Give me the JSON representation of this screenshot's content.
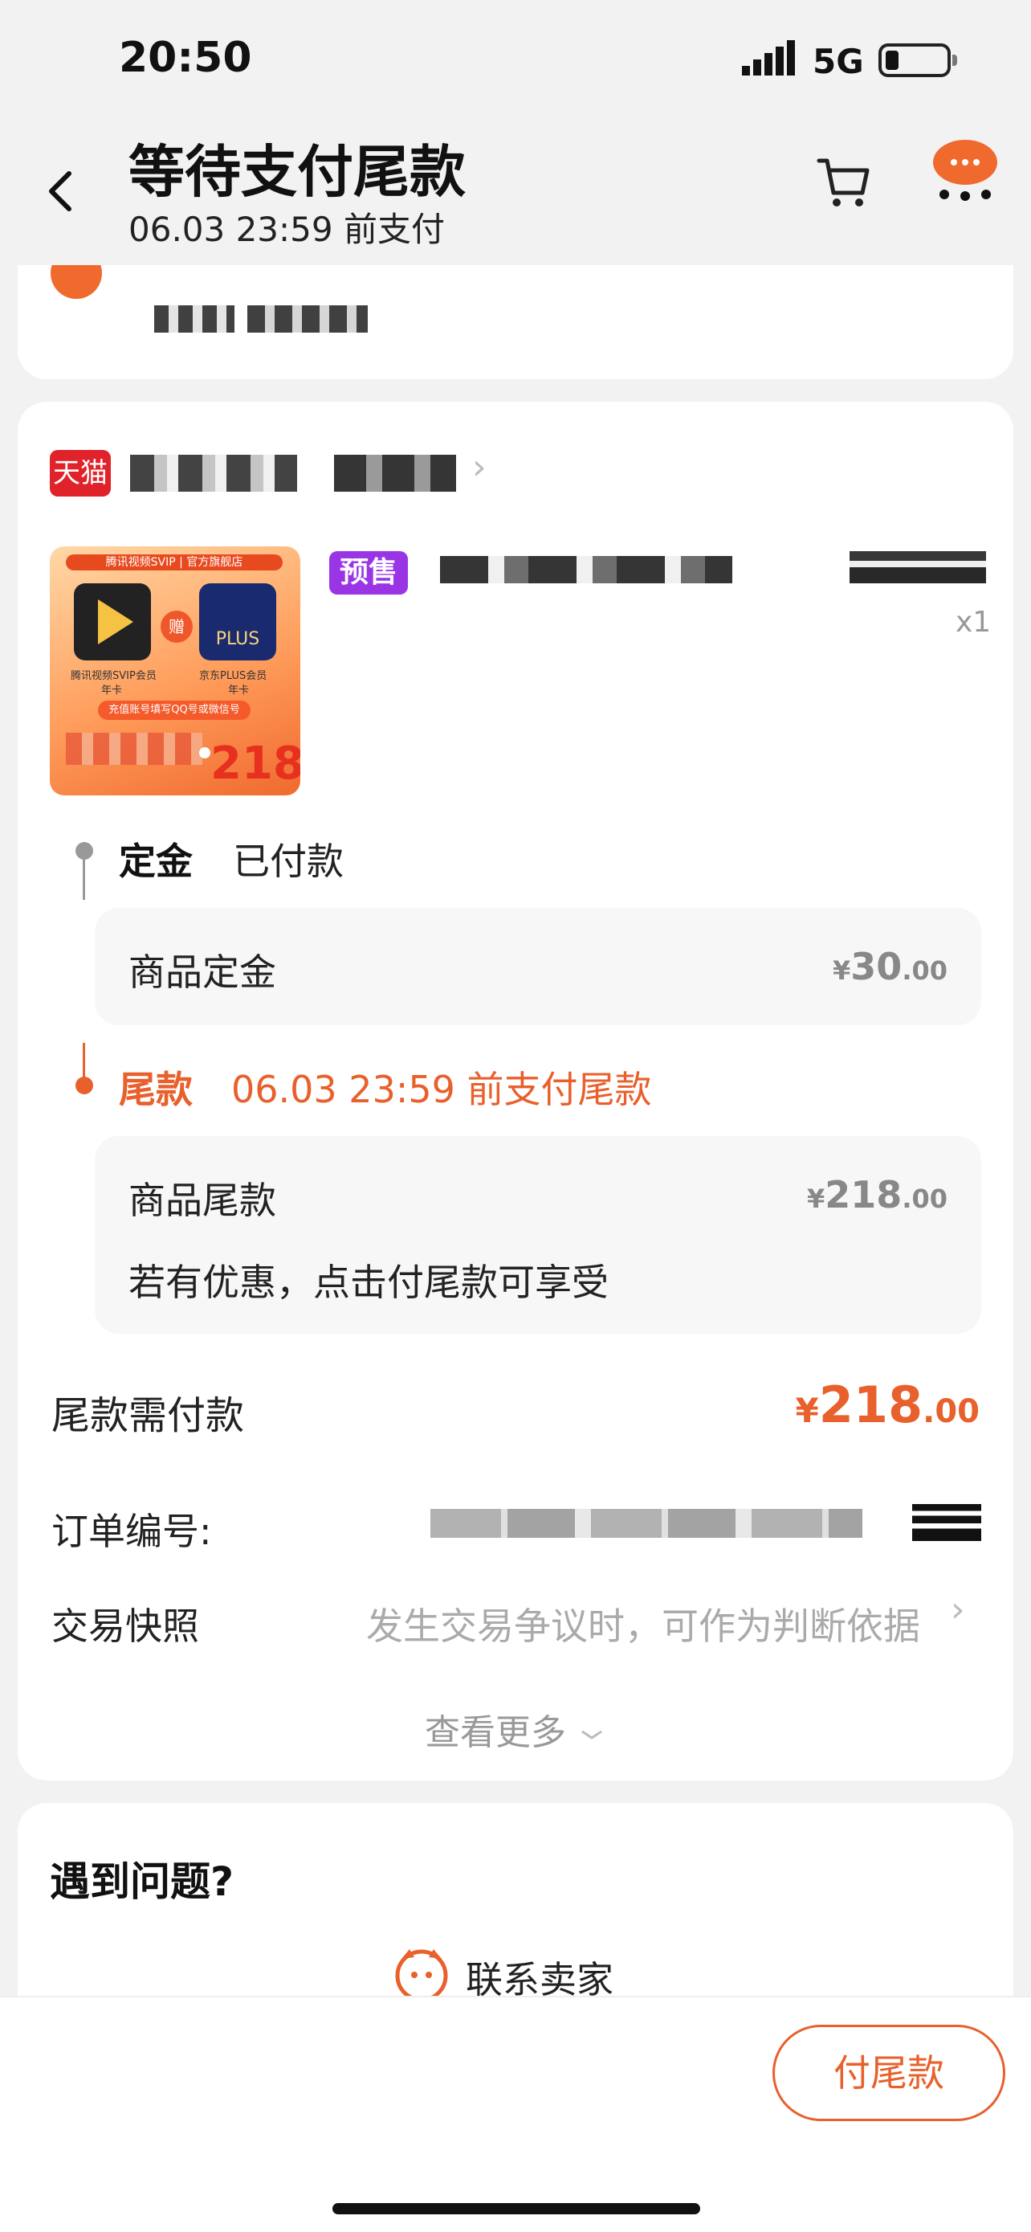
{
  "status_bar": {
    "time": "20:50",
    "network": "5G",
    "battery_level": 0.2
  },
  "nav": {
    "title": "等待支付尾款",
    "subtitle": "06.03 23:59 前支付",
    "icons": [
      "back-arrow-icon",
      "cart-icon",
      "more-bubble-icon"
    ]
  },
  "store": {
    "badge": "天猫"
  },
  "product": {
    "tag": "预售",
    "quantity": "x1",
    "image": {
      "banner": "腾讯视频SVIP | 官方旗舰店",
      "left_label": "腾讯视频SVIP会员",
      "left_sub": "年卡",
      "gift": "赠",
      "right_logo": "PLUS",
      "right_label": "京东PLUS会员",
      "right_sub": "年卡",
      "strip": "充值账号填写QQ号或微信号",
      "price": "218"
    }
  },
  "deposit": {
    "label": "定金",
    "status": "已付款",
    "item_label": "商品定金",
    "currency": "¥",
    "amount_int": "30",
    "amount_dec": ".00"
  },
  "balance": {
    "label": "尾款",
    "status": "06.03 23:59 前支付尾款",
    "item_label": "商品尾款",
    "currency": "¥",
    "amount_int": "218",
    "amount_dec": ".00",
    "note": "若有优惠，点击付尾款可享受"
  },
  "due": {
    "label": "尾款需付款",
    "currency": "¥",
    "amount_int": "218",
    "amount_dec": ".00"
  },
  "order": {
    "number_label": "订单编号:"
  },
  "snapshot": {
    "label": "交易快照",
    "hint": "发生交易争议时，可作为判断依据"
  },
  "see_more": "查看更多",
  "help": {
    "title": "遇到问题?",
    "contact_seller": "联系卖家"
  },
  "footer": {
    "pay_button": "付尾款"
  },
  "colors": {
    "accent": "#e8602c",
    "presale": "#9a35e6",
    "tmall": "#e0232a"
  }
}
